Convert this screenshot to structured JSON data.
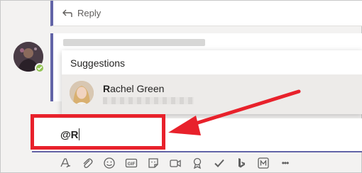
{
  "thread": {
    "reply_label": "Reply"
  },
  "suggestions": {
    "title": "Suggestions",
    "items": [
      {
        "match": "R",
        "rest": "achel Green"
      }
    ]
  },
  "compose": {
    "value": "@R"
  },
  "annotation": {
    "color": "#e8212b"
  },
  "toolbar": {
    "icons": [
      "format-icon",
      "attach-icon",
      "emoji-icon",
      "gif-icon",
      "sticker-icon",
      "meet-now-icon",
      "praise-icon",
      "approvals-icon",
      "bing-icon",
      "app-icon",
      "more-options-icon"
    ],
    "gif_label": "GIF",
    "more_label": "•••"
  }
}
